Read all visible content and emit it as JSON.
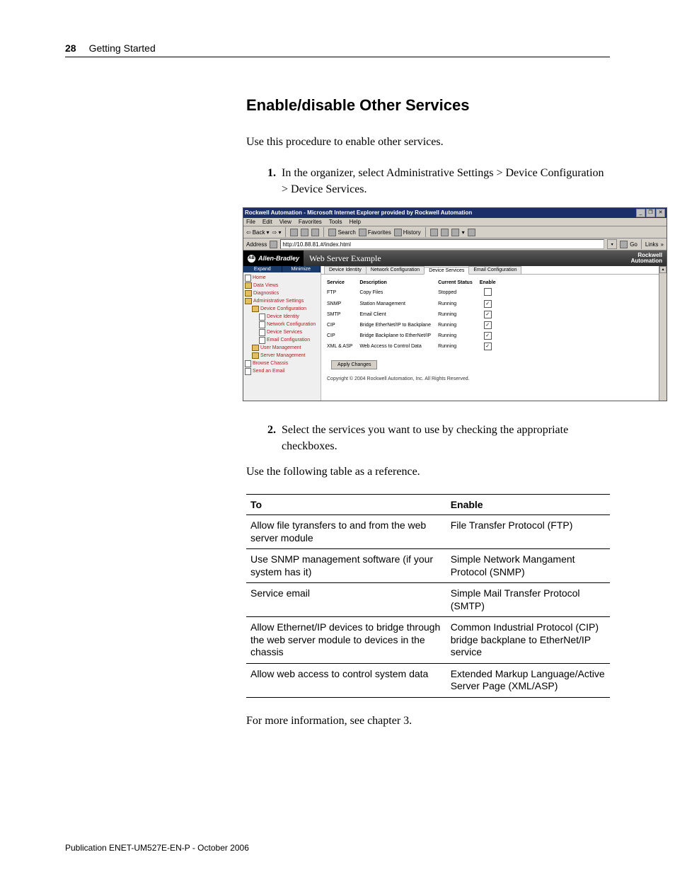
{
  "pageNumber": "28",
  "chapter": "Getting Started",
  "sectionTitle": "Enable/disable Other Services",
  "intro": "Use this procedure to enable other services.",
  "step1": "In the organizer, select Administrative Settings > Device Configuration > Device Services.",
  "step2": "Select the services you want to use by checking the appropriate checkboxes.",
  "note1": "Use the following table as a reference.",
  "note2": "For more information, see chapter 3.",
  "publication": "Publication ENET-UM527E-EN-P - October 2006",
  "reftable": {
    "head": {
      "to": "To",
      "enable": "Enable"
    },
    "rows": [
      {
        "to": "Allow file tyransfers to and from the web server module",
        "enable": "File Transfer Protocol (FTP)"
      },
      {
        "to": "Use SNMP management software (if your system has it)",
        "enable": "Simple Network Mangament Protocol (SNMP)"
      },
      {
        "to": "Service email",
        "enable": "Simple Mail Transfer Protocol (SMTP)"
      },
      {
        "to": "Allow Ethernet/IP devices to bridge through the web server module to devices in the chassis",
        "enable": "Common Industrial Protocol (CIP) bridge backplane to EtherNet/IP service"
      },
      {
        "to": "Allow web access to control system  data",
        "enable": "Extended Markup Language/Active Server Page (XML/ASP)"
      }
    ]
  },
  "mock": {
    "title": "Rockwell Automation - Microsoft Internet Explorer provided by Rockwell Automation",
    "menus": [
      "File",
      "Edit",
      "View",
      "Favorites",
      "Tools",
      "Help"
    ],
    "toolbar": {
      "back": "Back",
      "search": "Search",
      "favorites": "Favorites",
      "history": "History"
    },
    "addressLabel": "Address",
    "addressUrl": "http://10.88.81.#/index.html",
    "goLabel": "Go",
    "linksLabel": "Links",
    "brandAB": "Allen-Bradley",
    "brandTitle": "Web Server Example",
    "brandRock1": "Rockwell",
    "brandRock2": "Automation",
    "nav": {
      "expand": "Expand",
      "minimize": "Minimize",
      "items": [
        "Home",
        "Data Views",
        "Diagnostics",
        "Administrative Settings",
        "Device Configuration",
        "Device Identity",
        "Network Configuration",
        "Device Services",
        "Email Configuration",
        "User Management",
        "Server Management",
        "Browse Chassis",
        "Send an Email"
      ]
    },
    "tabs": [
      "Device Identity",
      "Network Configuration",
      "Device Services",
      "Email Configuration"
    ],
    "services": {
      "head": [
        "Service",
        "Description",
        "Current Status",
        "Enable"
      ],
      "rows": [
        {
          "svc": "FTP",
          "desc": "Copy Files",
          "status": "Stopped",
          "checked": false
        },
        {
          "svc": "SNMP",
          "desc": "Station Management",
          "status": "Running",
          "checked": true
        },
        {
          "svc": "SMTP",
          "desc": "Email Client",
          "status": "Running",
          "checked": true
        },
        {
          "svc": "CIP",
          "desc": "Bridge EtherNet/IP to Backplane",
          "status": "Running",
          "checked": true
        },
        {
          "svc": "CIP",
          "desc": "Bridge Backplane to EtherNet/IP",
          "status": "Running",
          "checked": true
        },
        {
          "svc": "XML & ASP",
          "desc": "Web Access to Control Data",
          "status": "Running",
          "checked": true
        }
      ]
    },
    "apply": "Apply Changes",
    "copyright": "Copyright © 2004 Rockwell Automation, Inc. All Rights Reserved."
  }
}
